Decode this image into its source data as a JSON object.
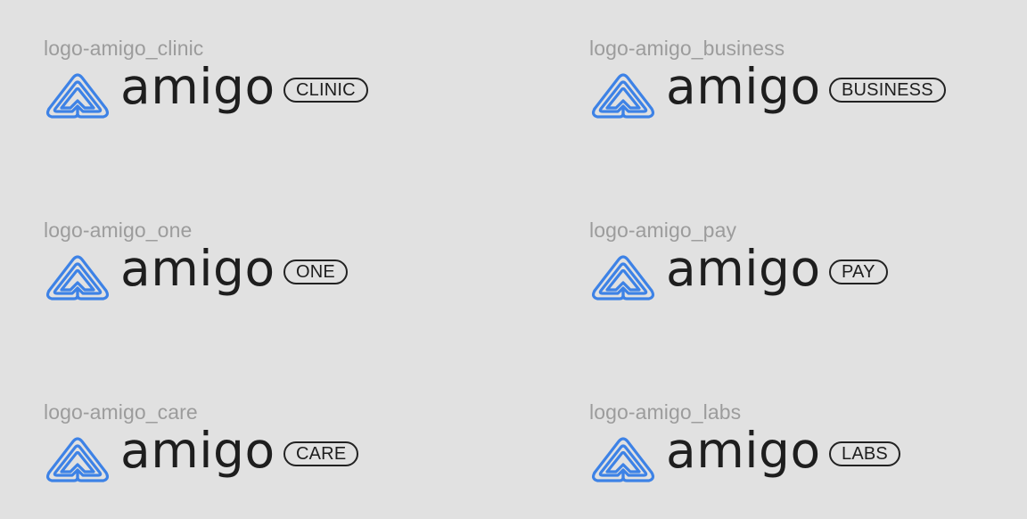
{
  "colors": {
    "background": "#e1e1e1",
    "caption": "#9c9c9c",
    "brand_blue": "#3d82e6",
    "wordmark": "#1e1e1e"
  },
  "logos": [
    {
      "caption": "logo-amigo_clinic",
      "wordmark": "amigo",
      "badge": "CLINIC",
      "icon": "amigo-heart-icon"
    },
    {
      "caption": "logo-amigo_business",
      "wordmark": "amigo",
      "badge": "BUSINESS",
      "icon": "amigo-heart-icon"
    },
    {
      "caption": "logo-amigo_one",
      "wordmark": "amigo",
      "badge": "ONE",
      "icon": "amigo-heart-icon"
    },
    {
      "caption": "logo-amigo_pay",
      "wordmark": "amigo",
      "badge": "PAY",
      "icon": "amigo-heart-icon"
    },
    {
      "caption": "logo-amigo_care",
      "wordmark": "amigo",
      "badge": "CARE",
      "icon": "amigo-heart-icon"
    },
    {
      "caption": "logo-amigo_labs",
      "wordmark": "amigo",
      "badge": "LABS",
      "icon": "amigo-heart-icon"
    }
  ]
}
